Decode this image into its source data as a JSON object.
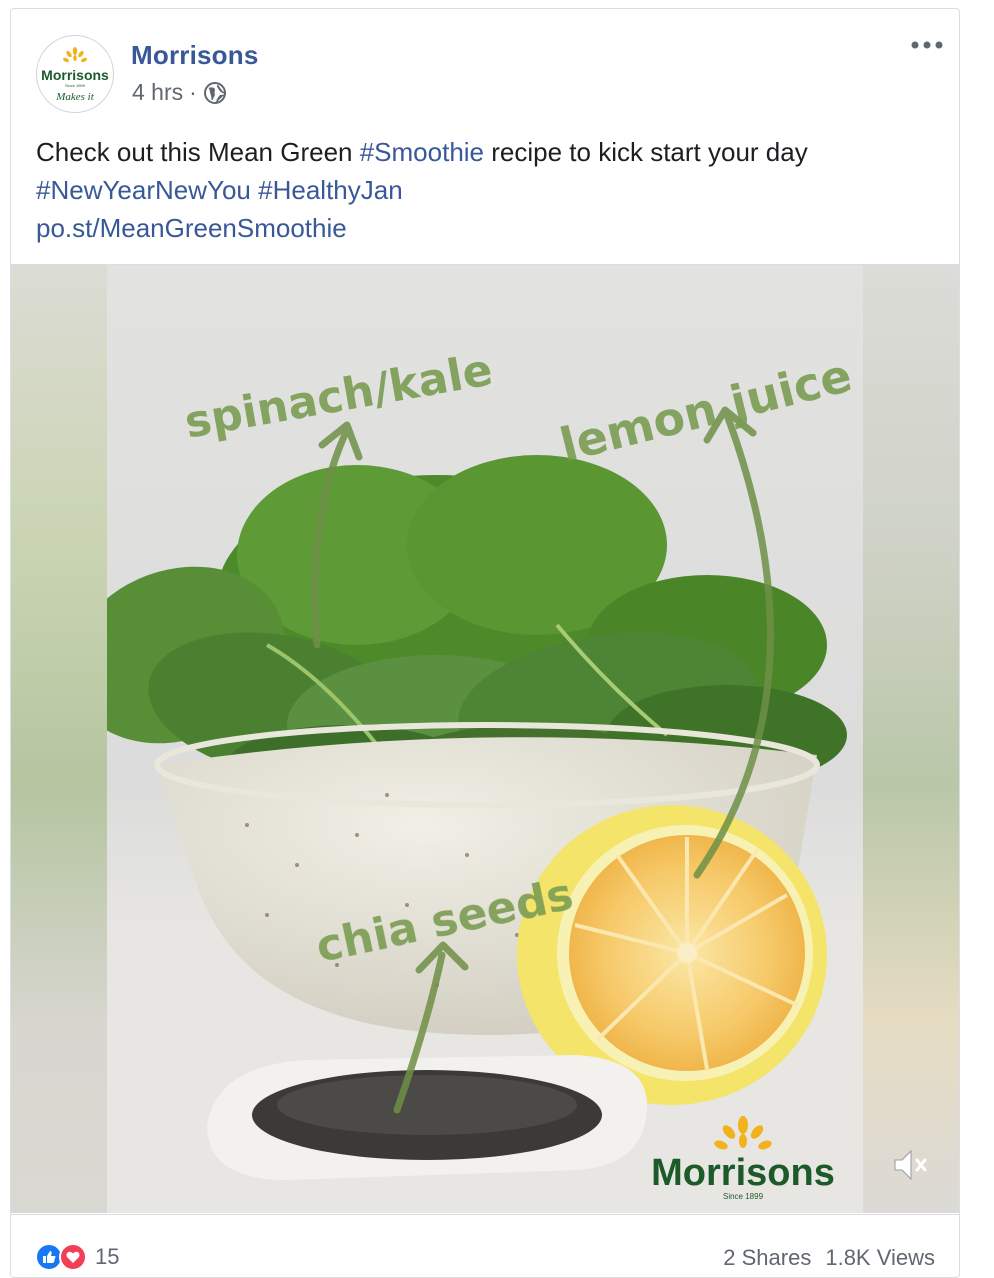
{
  "post": {
    "page_name": "Morrisons",
    "time": "4 hrs",
    "separator": "·",
    "avatar": {
      "brand": "Morrisons",
      "since": "Since 1899",
      "tagline": "Makes it"
    },
    "text": {
      "part1": "Check out this Mean Green ",
      "tag1": "#Smoothie",
      "part2": " recipe to kick start your day",
      "tag2": "#NewYearNewYou",
      "tag3": "#HealthyJan",
      "link": "po.st/MeanGreenSmoothie"
    }
  },
  "media": {
    "labels": {
      "spinach": "spinach/kale",
      "lemon": "lemon juice",
      "chia": "chia seeds"
    },
    "logo": {
      "brand": "Morrisons",
      "since": "Since 1899"
    },
    "colors": {
      "label_green": "#7a9c52",
      "arrow_green": "#6f8f47",
      "logo_green": "#1d5a2a",
      "logo_gold": "#f2b21b"
    }
  },
  "footer": {
    "reaction_count": "15",
    "shares": "2 Shares",
    "views": "1.8K Views"
  },
  "icons": [
    "globe-icon",
    "more-icon",
    "like-reaction-icon",
    "love-reaction-icon",
    "mute-icon"
  ]
}
